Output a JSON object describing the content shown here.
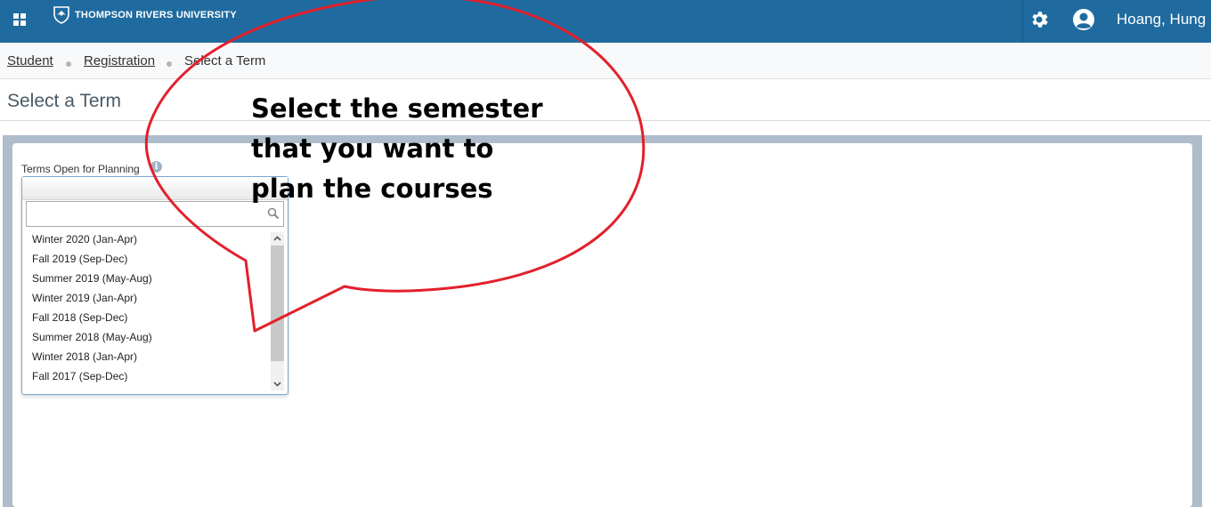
{
  "header": {
    "logo_text": "THOMPSON RIVERS UNIVERSITY",
    "username": "Hoang, Hung"
  },
  "breadcrumb": {
    "items": [
      {
        "label": "Student"
      },
      {
        "label": "Registration"
      },
      {
        "label": "Select a Term"
      }
    ]
  },
  "page": {
    "title": "Select a Term"
  },
  "term_select": {
    "label": "Terms Open for Planning",
    "search_value": "",
    "options": [
      "Winter 2020 (Jan-Apr)",
      "Fall 2019 (Sep-Dec)",
      "Summer 2019 (May-Aug)",
      "Winter 2019 (Jan-Apr)",
      "Fall 2018 (Sep-Dec)",
      "Summer 2018 (May-Aug)",
      "Winter 2018 (Jan-Apr)",
      "Fall 2017 (Sep-Dec)"
    ]
  },
  "annotation": {
    "text": "Select the semester\nthat you want to\nplan the courses",
    "stroke_color": "#e2202c"
  },
  "icons": {
    "apps": "apps-grid-icon",
    "gear": "gear-icon",
    "user": "user-avatar-icon",
    "info": "info-icon",
    "search": "search-icon"
  }
}
